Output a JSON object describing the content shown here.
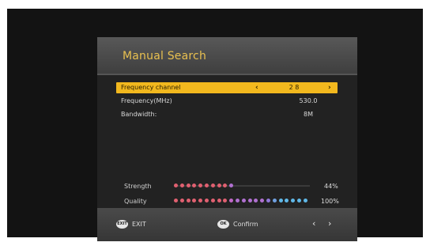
{
  "title": "Manual Search",
  "rows": [
    {
      "label": "Frequency channel",
      "value": "2 8",
      "selected": true,
      "left_arrow": "‹",
      "right_arrow": "›"
    },
    {
      "label": "Frequency(MHz)",
      "value": "530.0",
      "selected": false
    },
    {
      "label": "Bandwidth:",
      "value": "8M",
      "selected": false
    }
  ],
  "meters": {
    "strength": {
      "label": "Strength",
      "percent_label": "44%",
      "level": 0.44,
      "dot_colors": [
        "#e06070",
        "#e06070",
        "#e06070",
        "#e06070",
        "#e06070",
        "#e06070",
        "#e06070",
        "#e06070",
        "#e06070",
        "#b070d0"
      ]
    },
    "quality": {
      "label": "Quality",
      "percent_label": "100%",
      "level": 1.0,
      "dot_colors": [
        "#e06070",
        "#e06070",
        "#e06070",
        "#e06070",
        "#e06070",
        "#e06070",
        "#e06070",
        "#e06070",
        "#e06070",
        "#c068c8",
        "#b070d0",
        "#b070d0",
        "#b070d0",
        "#b070d0",
        "#b070d0",
        "#9078d8",
        "#70a0e0",
        "#60b8e8",
        "#60b8e8",
        "#60b8e8",
        "#60b8e8",
        "#60b8e8"
      ]
    }
  },
  "footer": {
    "exit_icon": "EXIT",
    "exit_label": "EXIT",
    "ok_icon": "OK",
    "confirm_label": "Confirm",
    "nav_left": "‹",
    "nav_right": "›"
  },
  "colors": {
    "title": "#e8c050",
    "highlight": "#f2b81e"
  }
}
